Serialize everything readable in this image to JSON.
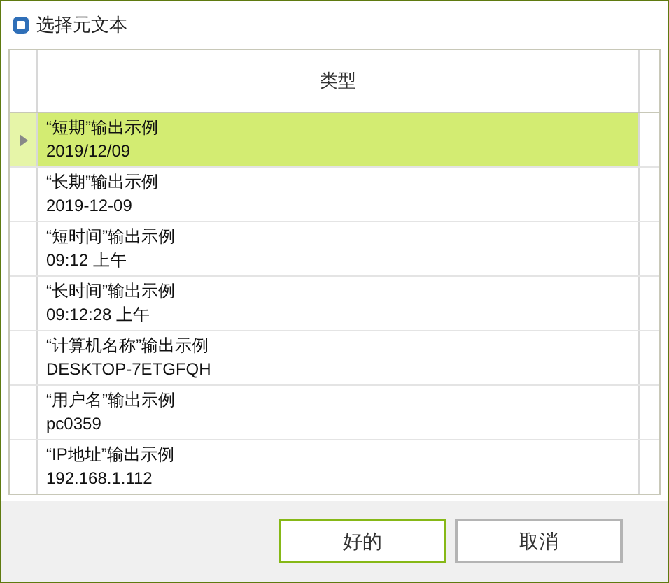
{
  "window": {
    "title": "选择元文本"
  },
  "table": {
    "columns": [
      "类型"
    ],
    "rows": [
      {
        "name": "“短期”输出示例",
        "example": "2019/12/09",
        "selected": true
      },
      {
        "name": "“长期”输出示例",
        "example": "2019-12-09",
        "selected": false
      },
      {
        "name": "“短时间”输出示例",
        "example": "09:12 上午",
        "selected": false
      },
      {
        "name": "“长时间”输出示例",
        "example": "09:12:28 上午",
        "selected": false
      },
      {
        "name": "“计算机名称”输出示例",
        "example": "DESKTOP-7ETGFQH",
        "selected": false
      },
      {
        "name": "“用户名”输出示例",
        "example": "pc0359",
        "selected": false
      },
      {
        "name": "“IP地址”输出示例",
        "example": "192.168.1.112",
        "selected": false
      }
    ]
  },
  "buttons": [
    {
      "label": "好的",
      "default": true
    },
    {
      "label": "取消",
      "default": false
    }
  ]
}
